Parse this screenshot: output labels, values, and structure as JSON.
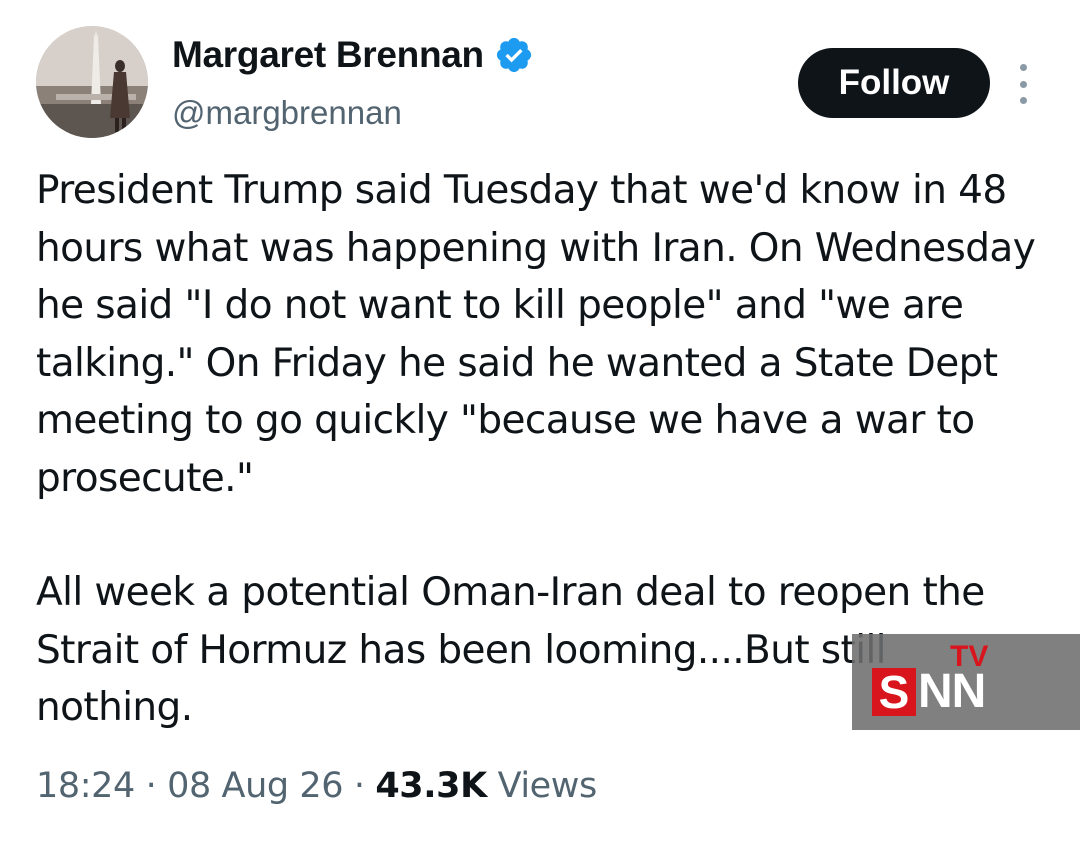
{
  "author": {
    "display_name": "Margaret Brennan",
    "handle": "@margbrennan",
    "verified_icon": "verified-badge-icon",
    "avatar_icon": "avatar-photo"
  },
  "actions": {
    "follow_label": "Follow",
    "more_icon": "more-options-icon"
  },
  "tweet": {
    "paragraphs": [
      "President Trump said Tuesday that we'd know in 48 hours what was happening with Iran. On Wednesday he said \"I do not want to kill people\" and \"we are talking.\" On Friday he said he wanted a State Dept meeting to go quickly \"because we have a war to prosecute.\"",
      "All week a potential Oman-Iran deal to reopen the Strait of Hormuz has been looming....But still nothing."
    ]
  },
  "meta": {
    "time": "18:24",
    "separator": "·",
    "date": "08 Aug 26",
    "views_count": "43.3K",
    "views_label": "Views"
  },
  "watermark": {
    "s": "S",
    "nn": "NN",
    "tv": "TV"
  },
  "colors": {
    "text_primary": "#0f1419",
    "text_secondary": "#536471",
    "verified_blue": "#1d9bf0",
    "follow_bg": "#0f1419",
    "watermark_red": "#d8151c"
  }
}
